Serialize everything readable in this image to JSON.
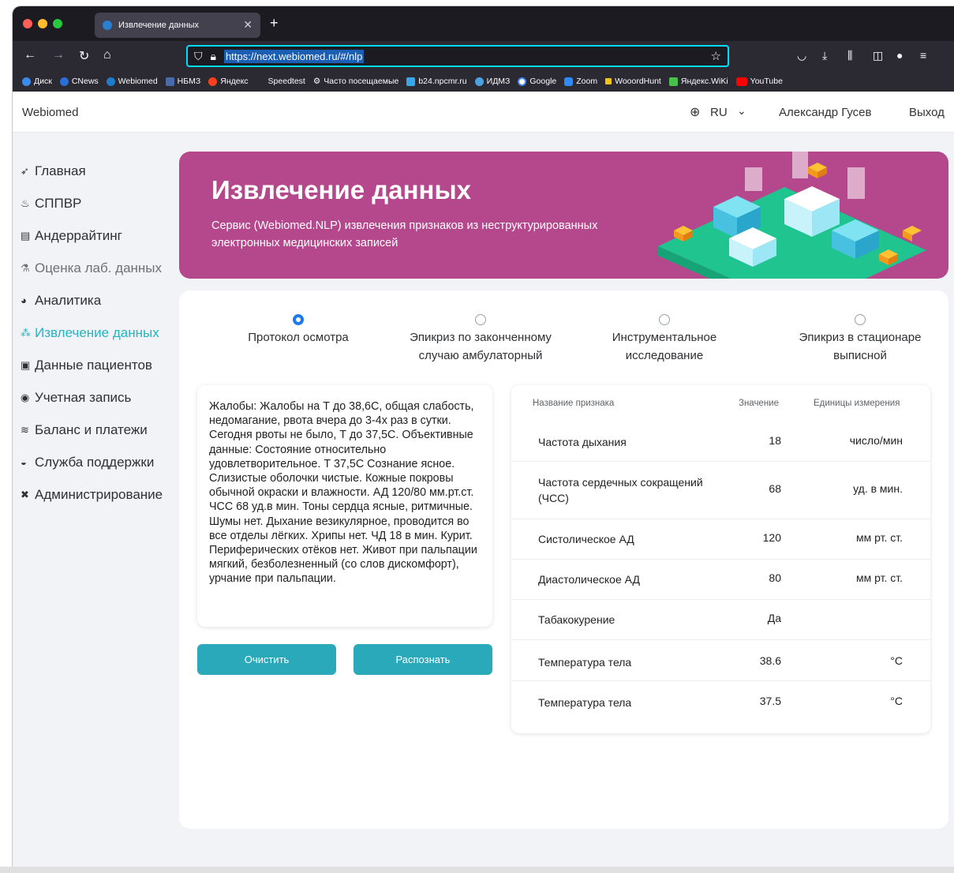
{
  "browser": {
    "tab_title": "Извлечение данных",
    "url": "https://next.webiomed.ru/#/nlp",
    "bookmarks": [
      "Диск",
      "CNews",
      "Webiomed",
      "НБМЗ",
      "Яндекс",
      "Speedtest",
      "Часто посещаемые",
      "b24.npcmr.ru",
      "ИДМЗ",
      "Google",
      "Zoom",
      "WooordHunt",
      "Яндекс.WiKi",
      "YouTube"
    ]
  },
  "header": {
    "brand": "Webiomed",
    "lang": "RU",
    "user": "Александр Гусев",
    "logout": "Выход"
  },
  "sidebar": {
    "items": [
      {
        "label": "Главная",
        "icon": "rocket-icon"
      },
      {
        "label": "СППВР",
        "icon": "fire-icon"
      },
      {
        "label": "Андеррайтинг",
        "icon": "document-icon"
      },
      {
        "label": "Оценка лаб. данных",
        "icon": "flask-icon"
      },
      {
        "label": "Аналитика",
        "icon": "pie-chart-icon"
      },
      {
        "label": "Извлечение данных",
        "icon": "nodes-icon"
      },
      {
        "label": "Данные пациентов",
        "icon": "patient-card-icon"
      },
      {
        "label": "Учетная запись",
        "icon": "user-circle-icon"
      },
      {
        "label": "Баланс и платежи",
        "icon": "coins-icon"
      },
      {
        "label": "Служба поддержки",
        "icon": "chat-icon"
      },
      {
        "label": "Администрирование",
        "icon": "tools-icon"
      }
    ]
  },
  "banner": {
    "title": "Извлечение данных",
    "subtitle": "Сервис (Webiomed.NLP) извлечения признаков из неструктурированных электронных медицинских записей"
  },
  "doc_types": [
    {
      "label_line1": "Протокол осмотра",
      "label_line2": "",
      "checked": true
    },
    {
      "label_line1": "Эпикриз по законченному",
      "label_line2": "случаю амбулаторный",
      "checked": false
    },
    {
      "label_line1": "Инструментальное",
      "label_line2": "исследование",
      "checked": false
    },
    {
      "label_line1": "Эпикриз в стационаре",
      "label_line2": "выписной",
      "checked": false
    }
  ],
  "input_text": "Жалобы: Жалобы на Т до 38,6С, общая слабость, недомагание, рвота вчера до 3-4х раз в сутки. Сегодня рвоты не было, Т до 37,5С. Объективные данные: Состояние относительно удовлетворительное. Т 37,5С Сознание ясное. Слизистые оболочки чистые. Кожные покровы обычной окраски и влажности. АД 120/80  мм.рт.ст. ЧСС 68 уд.в мин. Тоны сердца ясные, ритмичные. Шумы нет. Дыхание везикулярное, проводится во все отделы лёгких. Хрипы нет. ЧД 18  в мин. Курит. Периферических отёков нет. Живот при пальпации мягкий, безболезненный (со слов дискомфорт), урчание при пальпации.",
  "buttons": {
    "clear": "Очистить",
    "recognize": "Распознать"
  },
  "results": {
    "headers": {
      "name": "Название признака",
      "value": "Значение",
      "unit": "Единицы измерения"
    },
    "rows": [
      {
        "name": "Частота дыхания",
        "value": "18",
        "unit": "число/мин"
      },
      {
        "name": "Частота сердечных сокращений (ЧСС)",
        "value": "68",
        "unit": "уд. в мин."
      },
      {
        "name": "Систолическое АД",
        "value": "120",
        "unit": "мм рт. ст."
      },
      {
        "name": "Диастолическое АД",
        "value": "80",
        "unit": "мм рт. ст."
      },
      {
        "name": "Табакокурение",
        "value": "Да",
        "unit": ""
      },
      {
        "name": "Температура тела",
        "value": "38.6",
        "unit": "°C"
      },
      {
        "name": "Температура тела",
        "value": "37.5",
        "unit": "°C"
      }
    ]
  },
  "colors": {
    "accent": "#27b3c2",
    "banner": "#b5478d",
    "button": "#2aa9bb",
    "radio_checked": "#1e78ee"
  }
}
